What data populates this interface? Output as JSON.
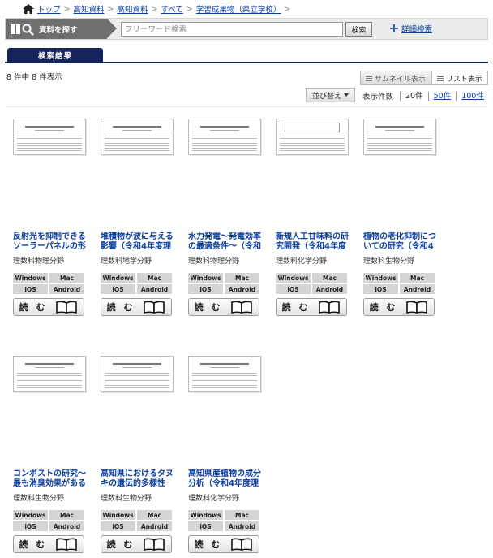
{
  "breadcrumb": {
    "items": [
      "トップ",
      "高知資料",
      "高知資料",
      "すべて",
      "学習成果物（県立学校）"
    ],
    "sep": ">"
  },
  "search": {
    "label": "資料を探す",
    "placeholder": "フリーワード検索",
    "button": "検索",
    "detail": "詳細検索"
  },
  "tabs": {
    "results": "検索結果"
  },
  "result_count": "8 件中 8 件表示",
  "view": {
    "thumbnail": "サムネイル表示",
    "list": "リスト表示"
  },
  "sort": {
    "label": "並び替え"
  },
  "perpage": {
    "label": "表示件数",
    "options": [
      "20件",
      "50件",
      "100件"
    ]
  },
  "platform_labels": [
    "Windows",
    "Mac",
    "iOS",
    "Android"
  ],
  "read_label": "読 む",
  "items": [
    {
      "title": "反射光を抑制できるソーラーパネルの形",
      "subject": "理数科物理分野"
    },
    {
      "title": "堆積物が波に与える影響（令和4年度理",
      "subject": "理数科地学分野"
    },
    {
      "title": "水力発電〜発電効率の最適条件〜（令和",
      "subject": "理数科物理分野"
    },
    {
      "title": "新規人工甘味料の研究開発（令和4年度",
      "subject": "理数科化学分野"
    },
    {
      "title": "植物の老化抑制についての研究（令和4",
      "subject": "理数科生物分野"
    },
    {
      "title": "コンポストの研究〜最も消臭効果がある",
      "subject": "理数科生物分野"
    },
    {
      "title": "高知県におけるタヌキの遺伝的多様性",
      "subject": "理数科生物分野"
    },
    {
      "title": "高知県産植物の成分分析（令和4年度理",
      "subject": "理数科化学分野"
    }
  ]
}
